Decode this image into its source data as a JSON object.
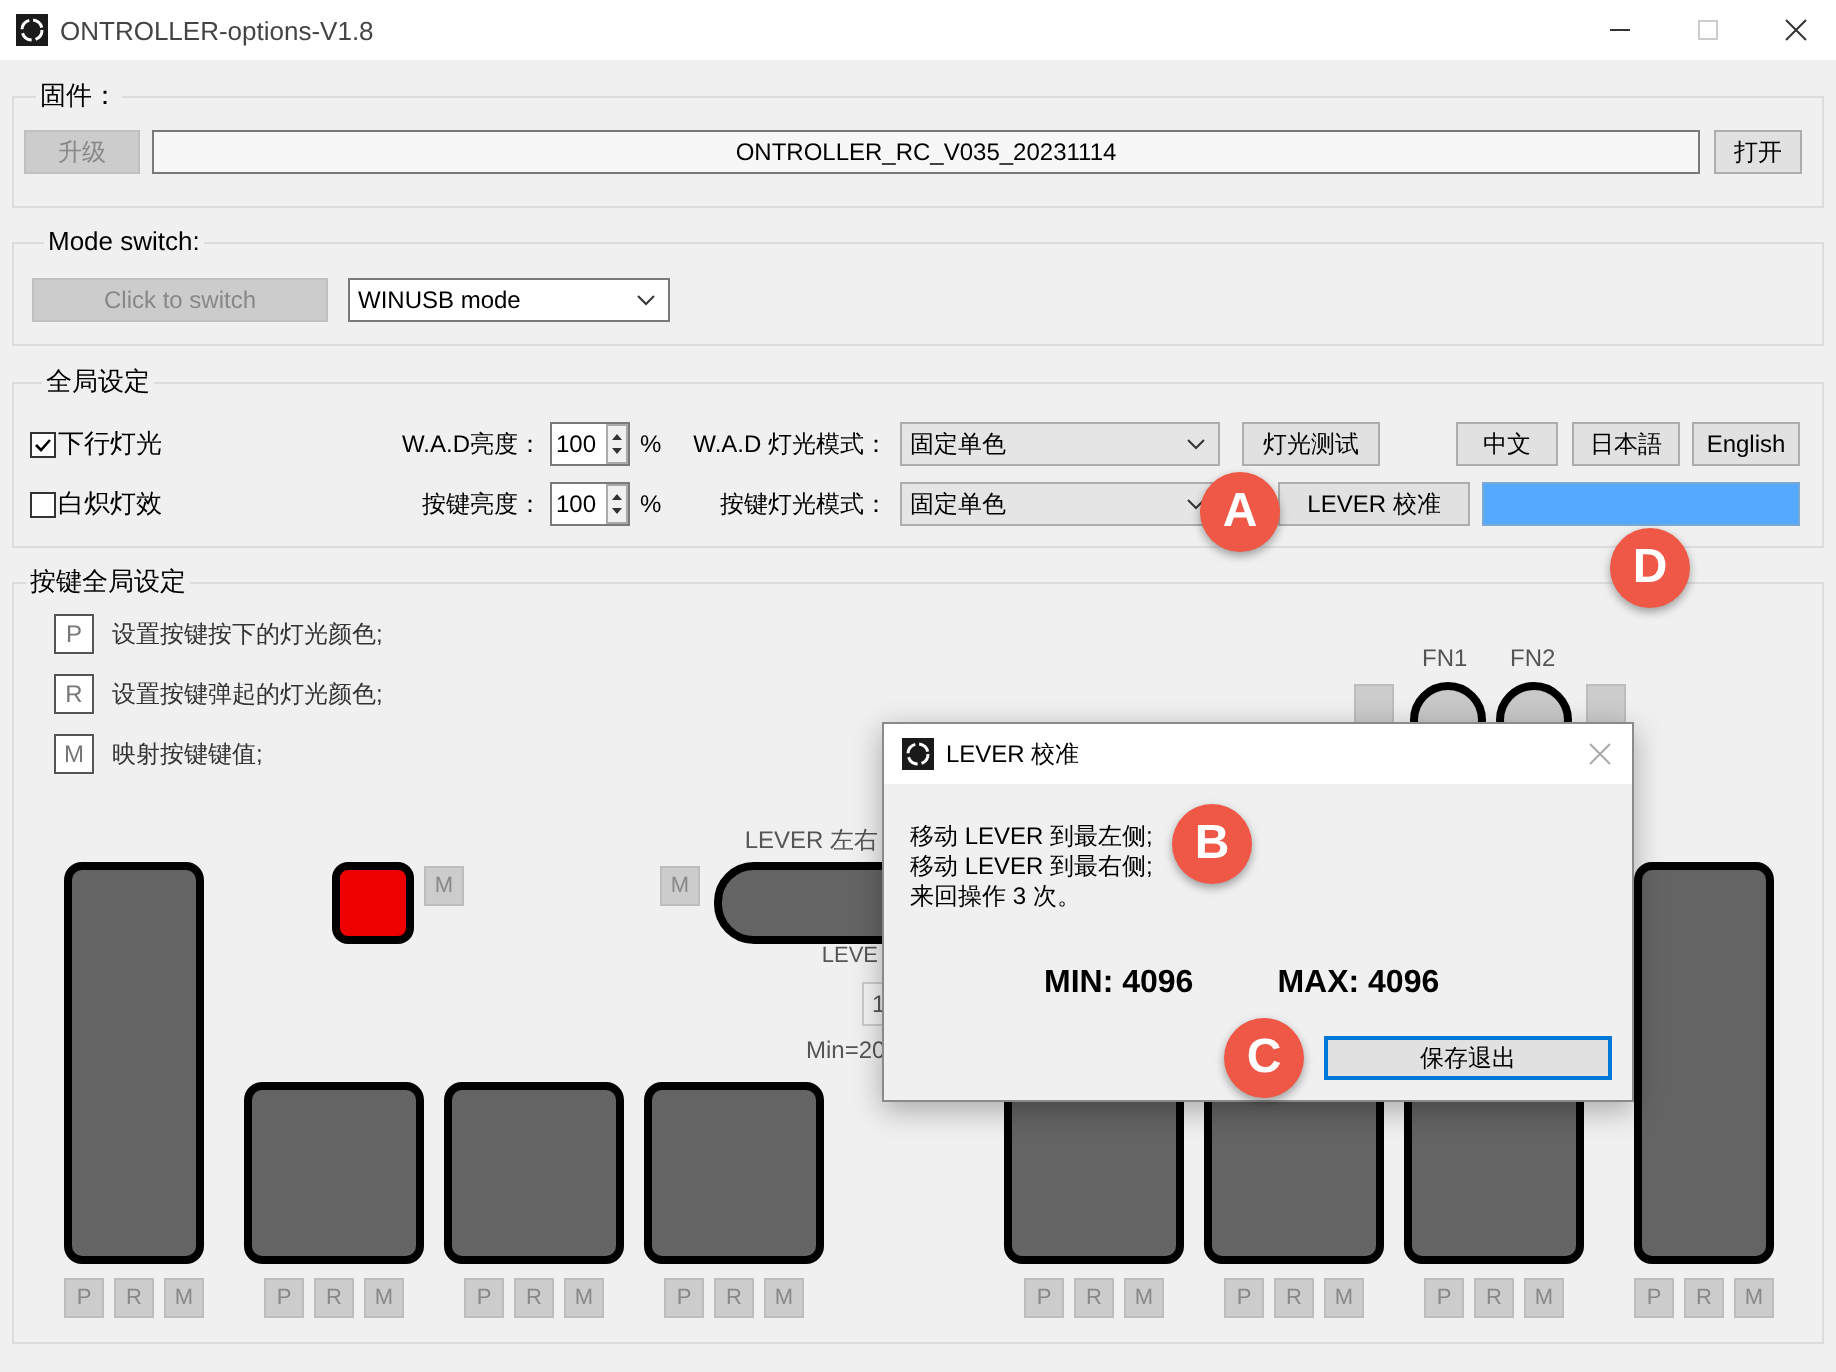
{
  "window": {
    "title": "ONTROLLER-options-V1.8"
  },
  "firmware": {
    "label": "固件：",
    "upgrade_button": {
      "label": "升级",
      "disabled": true
    },
    "file": "ONTROLLER_RC_V035_20231114",
    "open_button": "打开"
  },
  "mode_switch": {
    "label": "Mode switch:",
    "switch_button": {
      "label": "Click to switch",
      "disabled": true
    },
    "mode": "WINUSB mode"
  },
  "global_settings": {
    "label": "全局设定",
    "rows": [
      {
        "checkbox": {
          "label": "下行灯光",
          "checked": true
        },
        "brightness_label": "W.A.D亮度：",
        "brightness": "100",
        "unit": "%",
        "mode_label": "W.A.D 灯光模式：",
        "mode": "固定单色"
      },
      {
        "checkbox": {
          "label": "白炽灯效",
          "checked": false
        },
        "brightness_label": "按键亮度：",
        "brightness": "100",
        "unit": "%",
        "mode_label": "按键灯光模式：",
        "mode": "固定单色"
      }
    ],
    "light_test_button": "灯光测试",
    "lever_calibrate_button": "LEVER 校准",
    "languages": [
      "中文",
      "日本語",
      "English"
    ]
  },
  "key_settings": {
    "label": "按键全局设定",
    "legend": [
      {
        "key": "P",
        "text": "设置按键按下的灯光颜色;"
      },
      {
        "key": "R",
        "text": "设置按键弹起的灯光颜色;"
      },
      {
        "key": "M",
        "text": "映射按键键值;"
      }
    ],
    "fn_labels": [
      "FN1",
      "FN2"
    ],
    "red_key_map": "M",
    "lever_map": "M",
    "lever": {
      "label": "LEVER 左右",
      "sub_label": "LEVE",
      "value": "1",
      "range": "Min=20"
    },
    "pads": [
      {
        "kind": "tall",
        "buttons": [
          "P",
          "R",
          "M"
        ]
      },
      {
        "kind": "square",
        "buttons": [
          "P",
          "R",
          "M"
        ]
      },
      {
        "kind": "square",
        "buttons": [
          "P",
          "R",
          "M"
        ]
      },
      {
        "kind": "square",
        "buttons": [
          "P",
          "R",
          "M"
        ]
      },
      {
        "kind": "square",
        "buttons": [
          "P",
          "R",
          "M"
        ]
      },
      {
        "kind": "square",
        "buttons": [
          "P",
          "R",
          "M"
        ]
      },
      {
        "kind": "square",
        "buttons": [
          "P",
          "R",
          "M"
        ]
      },
      {
        "kind": "tall",
        "buttons": [
          "P",
          "R",
          "M"
        ]
      }
    ]
  },
  "dialog": {
    "title": "LEVER 校准",
    "lines": [
      "移动 LEVER 到最左侧;",
      "移动 LEVER 到最右侧;",
      "来回操作 3 次。"
    ],
    "min": "MIN: 4096",
    "max": "MAX: 4096",
    "save_button": "保存退出"
  },
  "annotations": [
    "A",
    "B",
    "C",
    "D"
  ]
}
